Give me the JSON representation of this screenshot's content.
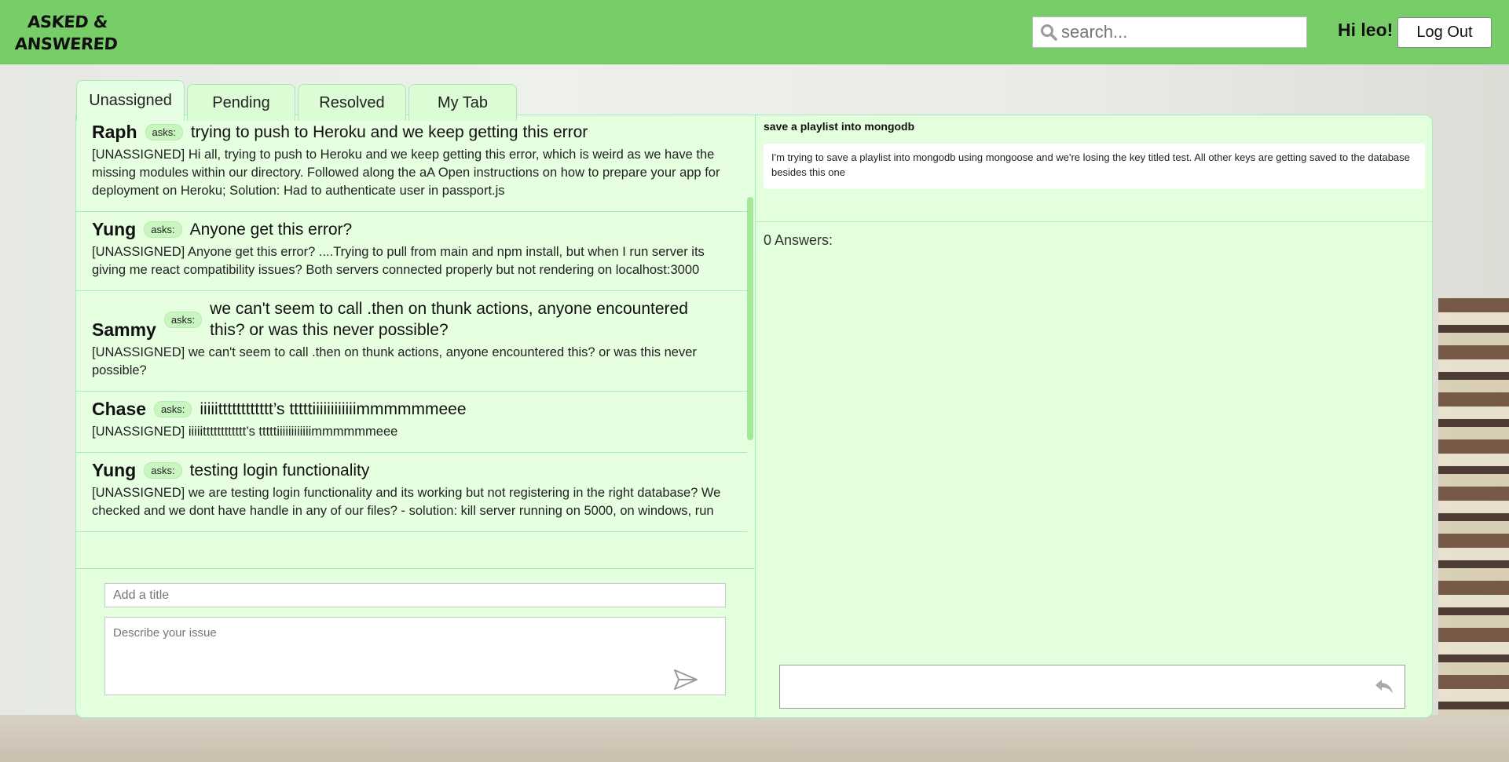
{
  "header": {
    "logo_line1": "Asked &",
    "logo_line2": "Answered",
    "search_placeholder": "search...",
    "greeting": "Hi leo!",
    "logout_label": "Log Out"
  },
  "tabs": [
    {
      "label": "Unassigned",
      "active": true
    },
    {
      "label": "Pending"
    },
    {
      "label": "Resolved"
    },
    {
      "label": "My Tab"
    }
  ],
  "questions": [
    {
      "author": "Raph",
      "asks_label": "asks:",
      "title": "trying to push to Heroku and we keep getting this error",
      "body": "[UNASSIGNED] Hi all, trying to push to Heroku and we keep getting this error, which is weird as we have the missing modules within our directory. Followed along the aA Open instructions on how to prepare your app for deployment on Heroku; Solution: Had to authenticate user in passport.js"
    },
    {
      "author": "Yung",
      "asks_label": "asks:",
      "title": "Anyone get this error?",
      "body": "[UNASSIGNED] Anyone get this error? ....Trying to pull from main and npm install, but when I run server its giving me react compatibility issues? Both servers connected properly but not rendering on localhost:3000"
    },
    {
      "author": "Sammy",
      "asks_label": "asks:",
      "title": "we can't seem to call .then on thunk actions, anyone encountered this? or was this never possible?",
      "body": "[UNASSIGNED] we can't seem to call .then on thunk actions, anyone encountered this? or was this never possible?"
    },
    {
      "author": "Chase",
      "asks_label": "asks:",
      "title": "iiiiitttttttttttt’s tttttiiiiiiiiiiiimmmmmmeee",
      "body": "[UNASSIGNED] iiiiitttttttttttt’s tttttiiiiiiiiiiiimmmmmmeee"
    },
    {
      "author": "Yung",
      "asks_label": "asks:",
      "title": "testing login functionality",
      "body": "[UNASSIGNED] we are testing login functionality and its working but not registering in the right database? We checked and we dont have handle in any of our files? - solution: kill server running on 5000, on windows, run"
    }
  ],
  "composer": {
    "title_placeholder": "Add a title",
    "description_placeholder": "Describe your issue"
  },
  "detail": {
    "title": "save a playlist into mongodb",
    "body": "I'm trying to save a playlist into mongodb using mongoose and we're losing the key titled test. All other keys are getting saved to the database besides this one",
    "answers_count_label": "0 Answers:",
    "reply_placeholder": ""
  },
  "colors": {
    "header": "#77cd67",
    "panel": "#e3ffdd",
    "border": "#a8eac0",
    "scrollbar": "#a5e898"
  }
}
